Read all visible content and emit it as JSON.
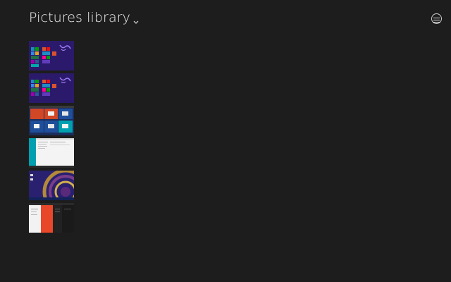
{
  "header": {
    "title": "Pictures library"
  },
  "icons": {
    "header_dropdown": "chevron-down-icon",
    "view_menu": "menu-lines-icon"
  },
  "colors": {
    "background": "#1d1d1d",
    "start_screen": "#2b1a6b",
    "accent_red": "#d24726",
    "accent_blue": "#1f4e9a",
    "accent_teal": "#00a0b0"
  },
  "thumbnails": [
    {
      "id": 1,
      "kind": "start-screen"
    },
    {
      "id": 2,
      "kind": "start-screen"
    },
    {
      "id": 3,
      "kind": "app-tiles"
    },
    {
      "id": 4,
      "kind": "settings-window"
    },
    {
      "id": 5,
      "kind": "desktop-wallpaper"
    },
    {
      "id": 6,
      "kind": "split-apps"
    }
  ]
}
